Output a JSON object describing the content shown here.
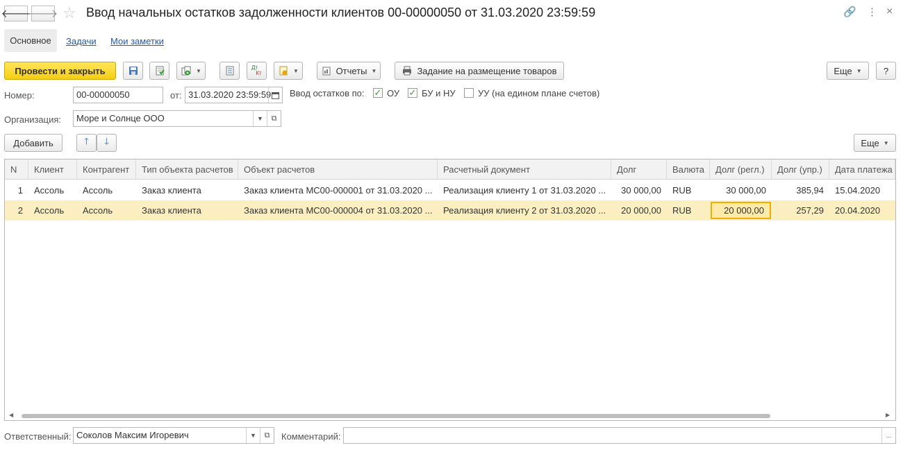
{
  "window": {
    "title": "Ввод начальных остатков задолженности клиентов 00-00000050 от 31.03.2020 23:59:59",
    "back_glyph": "🡐",
    "forward_glyph": "🡒",
    "star_glyph": "☆",
    "link_glyph": "🔗",
    "more_glyph": "⋮",
    "close_glyph": "×"
  },
  "tabs": [
    {
      "label": "Основное",
      "active": true
    },
    {
      "label": "Задачи"
    },
    {
      "label": "Мои заметки"
    }
  ],
  "toolbar": {
    "post_close": "Провести и закрыть",
    "save_icon": "save-icon",
    "post_icon": "post-icon",
    "create_based_icon": "create-based-icon",
    "journal_icon": "document-journal-icon",
    "dt_kt": {
      "top": "Дт",
      "bottom": "Кт"
    },
    "attach_icon": "attach-files-icon",
    "reports": "Отчеты",
    "placement_task": "Задание на размещение товаров",
    "more": "Еще",
    "help": "?"
  },
  "form": {
    "number_label": "Номер:",
    "number_value": "00-00000050",
    "from_label": "от:",
    "date_value": "31.03.2020 23:59:59",
    "balances_label": "Ввод остатков по:",
    "checks": [
      {
        "label": "ОУ",
        "checked": true
      },
      {
        "label": "БУ и НУ",
        "checked": true
      },
      {
        "label": "УУ (на едином плане счетов)",
        "checked": false
      }
    ],
    "org_label": "Организация:",
    "org_value": "Море и Солнце ООО",
    "check_glyph": "✓"
  },
  "table_toolbar": {
    "add": "Добавить",
    "up": "🡑",
    "down": "🡓",
    "more": "Еще"
  },
  "table": {
    "columns": [
      "N",
      "Клиент",
      "Контрагент",
      "Тип объекта расчетов",
      "Объект расчетов",
      "Расчетный документ",
      "Долг",
      "Валюта",
      "Долг (регл.)",
      "Долг (упр.)",
      "Дата платежа"
    ],
    "rows": [
      {
        "cells": [
          "1",
          "Ассоль",
          "Ассоль",
          "Заказ клиента",
          "Заказ клиента МС00-000001 от 31.03.2020 ...",
          "Реализация клиенту 1 от 31.03.2020 ...",
          "30 000,00",
          "RUB",
          "30 000,00",
          "385,94",
          "15.04.2020"
        ]
      },
      {
        "cells": [
          "2",
          "Ассоль",
          "Ассоль",
          "Заказ клиента",
          "Заказ клиента МС00-000004 от 31.03.2020 ...",
          "Реализация клиенту 2 от 31.03.2020 ...",
          "20 000,00",
          "RUB",
          "20 000,00",
          "257,29",
          "20.04.2020"
        ],
        "selected": true
      }
    ]
  },
  "footer": {
    "responsible_label": "Ответственный:",
    "responsible_value": "Соколов Максим Игоревич",
    "comment_label": "Комментарий:",
    "comment_value": "",
    "ellipsis": "..."
  }
}
